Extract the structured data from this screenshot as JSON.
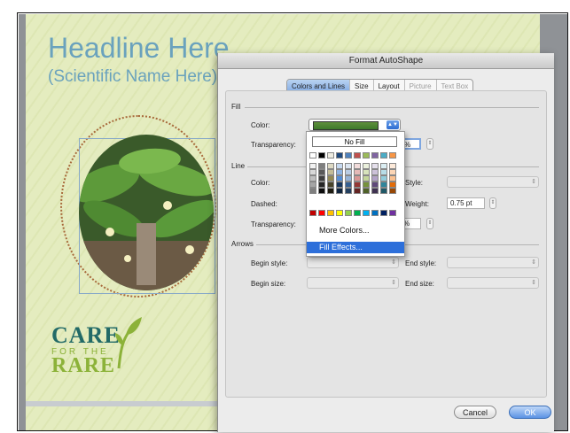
{
  "document": {
    "headline": "Headline Here",
    "scientific_name": "(Scientific Name Here)",
    "logo": {
      "care": "CARE",
      "for_the": "FOR THE",
      "rare": "RARE"
    }
  },
  "dialog": {
    "title": "Format AutoShape",
    "tabs": [
      {
        "label": "Colors and Lines",
        "state": "active"
      },
      {
        "label": "Size",
        "state": "enabled"
      },
      {
        "label": "Layout",
        "state": "enabled"
      },
      {
        "label": "Picture",
        "state": "disabled"
      },
      {
        "label": "Text Box",
        "state": "disabled"
      }
    ],
    "fill": {
      "section": "Fill",
      "color_label": "Color:",
      "transparency_label": "Transparency:",
      "transparency_value": "%"
    },
    "line": {
      "section": "Line",
      "color_label": "Color:",
      "dashed_label": "Dashed:",
      "transparency_label": "Transparency:",
      "transparency_value": "%",
      "style_label": "Style:",
      "weight_label": "Weight:",
      "weight_value": "0.75 pt"
    },
    "arrows": {
      "section": "Arrows",
      "begin_style_label": "Begin style:",
      "begin_size_label": "Begin size:",
      "end_style_label": "End style:",
      "end_size_label": "End size:"
    },
    "buttons": {
      "cancel": "Cancel",
      "ok": "OK"
    }
  },
  "color_popup": {
    "no_fill": "No Fill",
    "more_colors": "More Colors...",
    "fill_effects": "Fill Effects...",
    "theme_colors": [
      [
        "#ffffff",
        "#000000",
        "#eeece1",
        "#1f497d",
        "#4f81bd",
        "#c0504d",
        "#9bbb59",
        "#8064a2",
        "#4bacc6",
        "#f79646"
      ],
      [
        "#f2f2f2",
        "#7f7f7f",
        "#ddd9c3",
        "#c6d9f0",
        "#dbe5f1",
        "#f2dcdb",
        "#ebf1dd",
        "#e5e0ec",
        "#dbeef3",
        "#fdeada"
      ],
      [
        "#d8d8d8",
        "#595959",
        "#c4bd97",
        "#8db3e2",
        "#b8cce4",
        "#e5b9b7",
        "#d7e3bc",
        "#ccc1d9",
        "#b7dde8",
        "#fbd5b5"
      ],
      [
        "#bfbfbf",
        "#3f3f3f",
        "#938953",
        "#548dd4",
        "#95b3d7",
        "#d99694",
        "#c3d69b",
        "#b2a2c7",
        "#92cddc",
        "#fac08f"
      ],
      [
        "#a5a5a5",
        "#262626",
        "#494429",
        "#17365d",
        "#366092",
        "#953734",
        "#76923c",
        "#5f497a",
        "#31859b",
        "#e36c09"
      ],
      [
        "#7f7f7f",
        "#0c0c0c",
        "#1d1b10",
        "#0f243e",
        "#244061",
        "#632423",
        "#4f6128",
        "#3f3151",
        "#205867",
        "#974806"
      ]
    ],
    "standard_colors": [
      "#c00000",
      "#ff0000",
      "#ffc000",
      "#ffff00",
      "#92d050",
      "#00b050",
      "#00b0f0",
      "#0070c0",
      "#002060",
      "#7030a0"
    ]
  }
}
